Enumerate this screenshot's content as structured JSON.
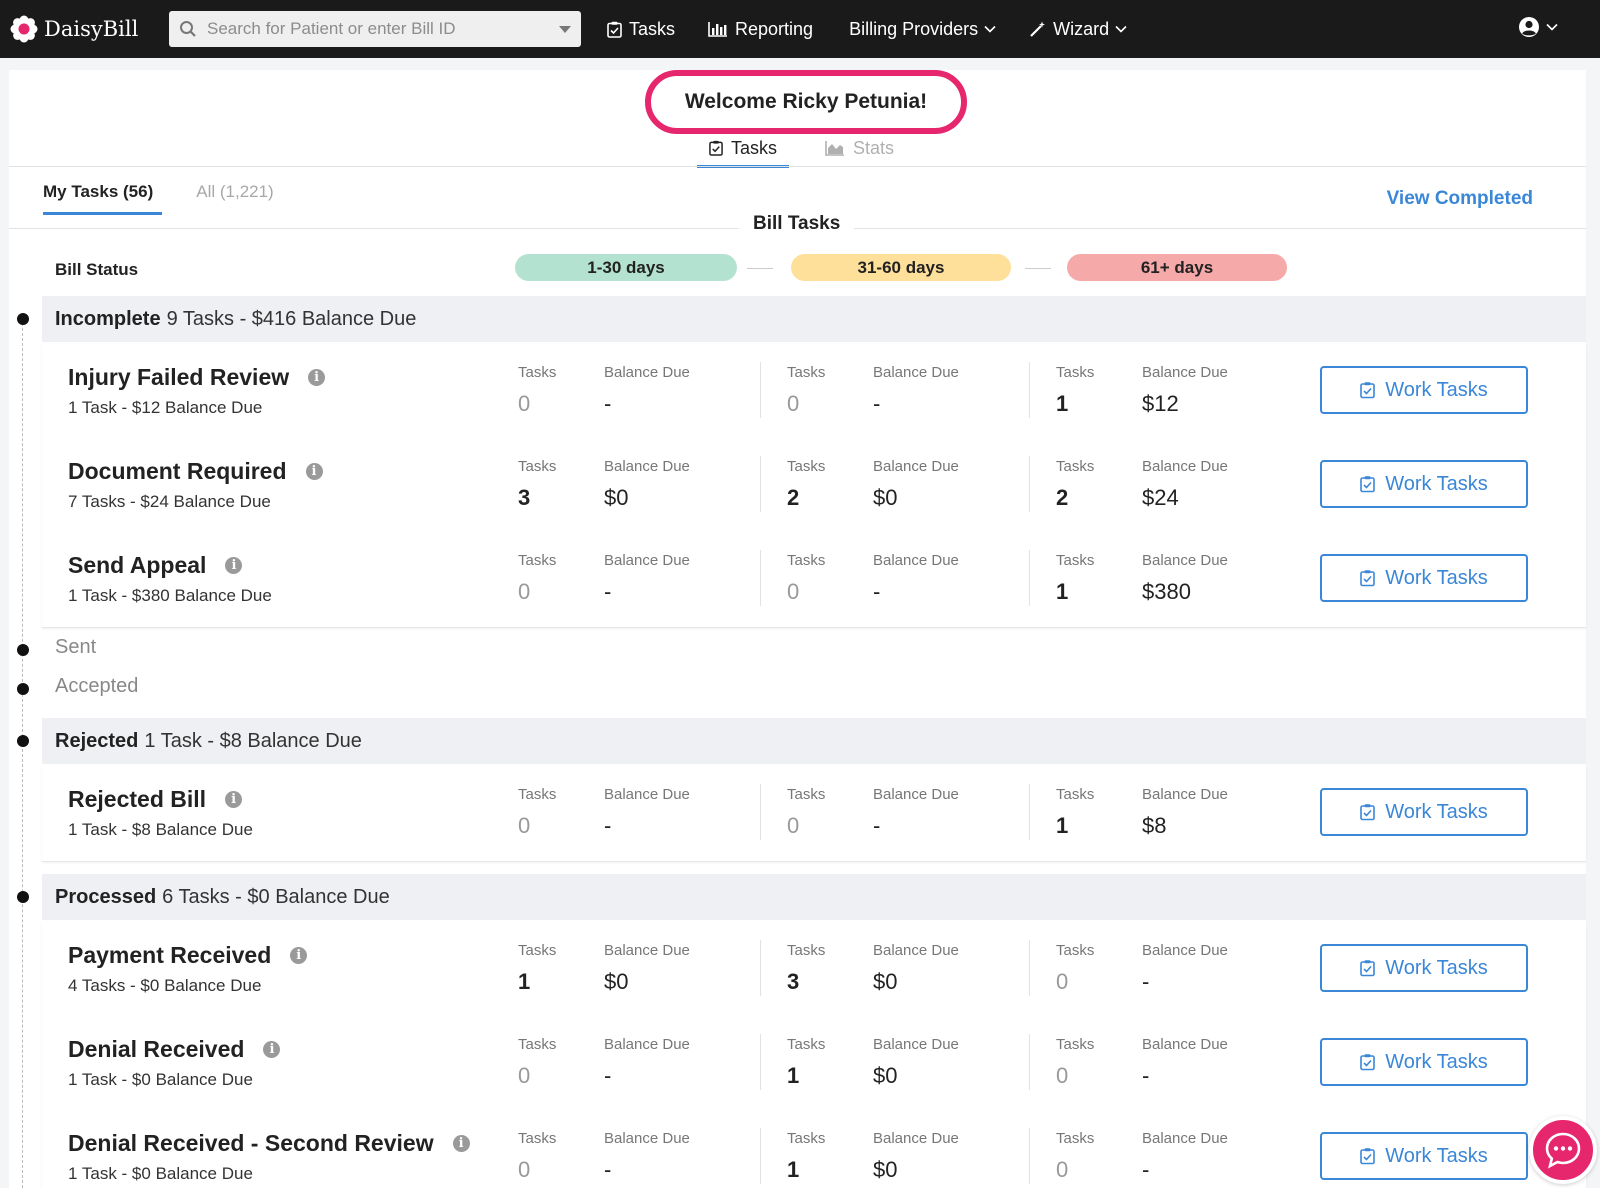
{
  "nav": {
    "brand": "DaisyBill",
    "search_placeholder": "Search for Patient or enter Bill ID",
    "items": [
      {
        "label": "Tasks",
        "icon": "clipboard-check-icon"
      },
      {
        "label": "Reporting",
        "icon": "bar-chart-icon"
      },
      {
        "label": "Billing Providers",
        "icon": "chevron-down-icon"
      },
      {
        "label": "Wizard",
        "icon": "magic-wand-icon"
      }
    ],
    "account_icon": "user-circle-icon"
  },
  "welcome": "Welcome Ricky Petunia!",
  "view_tabs": {
    "tasks": "Tasks",
    "stats": "Stats"
  },
  "sub_tabs": {
    "mine": "My Tasks (56)",
    "all": "All (1,221)"
  },
  "view_completed": "View Completed",
  "section_title": "Bill Tasks",
  "bill_status_label": "Bill Status",
  "aging": [
    {
      "label": "1-30 days",
      "color": "#b3e3d0"
    },
    {
      "label": "31-60 days",
      "color": "#ffe09a"
    },
    {
      "label": "61+ days",
      "color": "#f6a9a9"
    }
  ],
  "col_labels": {
    "tasks": "Tasks",
    "balance": "Balance Due"
  },
  "button_label": "Work Tasks",
  "groups": [
    {
      "name": "Incomplete",
      "summary": "9 Tasks - $416 Balance Due",
      "rows": [
        {
          "title": "Injury Failed Review",
          "sub": "1 Task - $12 Balance Due",
          "buckets": [
            [
              "0",
              "-"
            ],
            [
              "0",
              "-"
            ],
            [
              "1",
              "$12"
            ]
          ]
        },
        {
          "title": "Document Required",
          "sub": "7 Tasks - $24 Balance Due",
          "buckets": [
            [
              "3",
              "$0"
            ],
            [
              "2",
              "$0"
            ],
            [
              "2",
              "$24"
            ]
          ]
        },
        {
          "title": "Send Appeal",
          "sub": "1 Task - $380 Balance Due",
          "buckets": [
            [
              "0",
              "-"
            ],
            [
              "0",
              "-"
            ],
            [
              "1",
              "$380"
            ]
          ]
        }
      ]
    },
    {
      "name": "Sent"
    },
    {
      "name": "Accepted"
    },
    {
      "name": "Rejected",
      "summary": "1 Task - $8 Balance Due",
      "rows": [
        {
          "title": "Rejected Bill",
          "sub": "1 Task - $8 Balance Due",
          "buckets": [
            [
              "0",
              "-"
            ],
            [
              "0",
              "-"
            ],
            [
              "1",
              "$8"
            ]
          ]
        }
      ]
    },
    {
      "name": "Processed",
      "summary": "6 Tasks - $0 Balance Due",
      "rows": [
        {
          "title": "Payment Received",
          "sub": "4 Tasks - $0 Balance Due",
          "buckets": [
            [
              "1",
              "$0"
            ],
            [
              "3",
              "$0"
            ],
            [
              "0",
              "-"
            ]
          ]
        },
        {
          "title": "Denial Received",
          "sub": "1 Task - $0 Balance Due",
          "buckets": [
            [
              "0",
              "-"
            ],
            [
              "1",
              "$0"
            ],
            [
              "0",
              "-"
            ]
          ]
        },
        {
          "title": "Denial Received - Second Review",
          "sub": "1 Task - $0 Balance Due",
          "buckets": [
            [
              "0",
              "-"
            ],
            [
              "1",
              "$0"
            ],
            [
              "0",
              "-"
            ]
          ]
        }
      ]
    }
  ]
}
